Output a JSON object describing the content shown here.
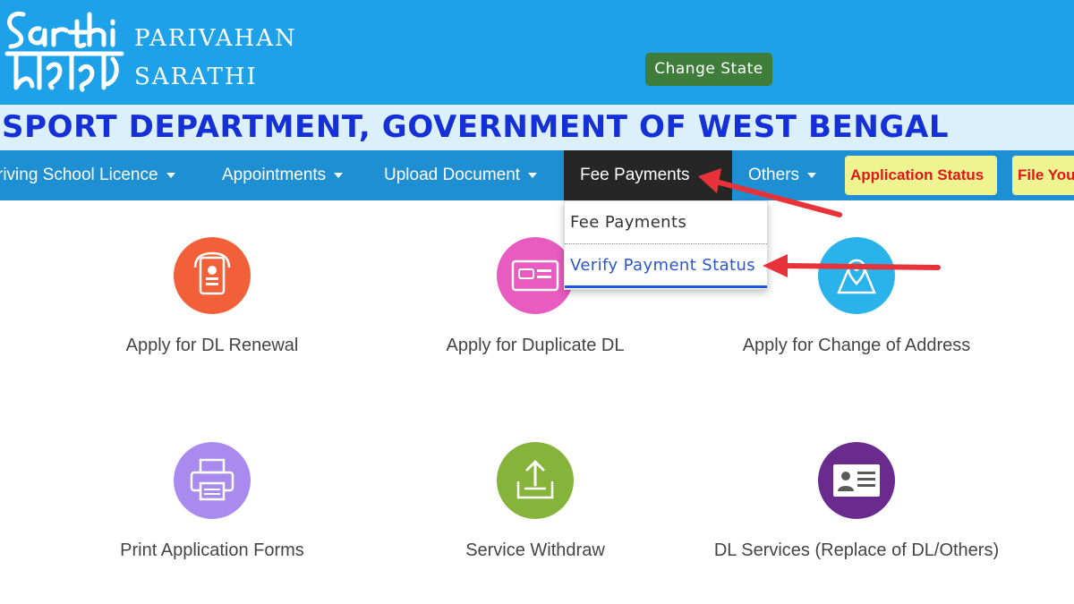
{
  "header": {
    "logo_line1": "PARIVAHAN",
    "logo_line2": "SARATHI",
    "change_state_label": "Change State",
    "brand_color": "#1da1e8"
  },
  "department": {
    "title": "SPORT DEPARTMENT, GOVERNMENT OF WEST BENGAL"
  },
  "nav": {
    "items": [
      {
        "label": "riving School Licence",
        "dropdown": true
      },
      {
        "label": "Appointments",
        "dropdown": true
      },
      {
        "label": "Upload Document",
        "dropdown": true
      },
      {
        "label": "Fee Payments",
        "dropdown": false,
        "active": true
      },
      {
        "label": "Others",
        "dropdown": true
      }
    ],
    "pills": [
      {
        "label": "Application Status"
      },
      {
        "label": "File You"
      }
    ]
  },
  "dropdown": {
    "items": [
      {
        "label": "Fee Payments"
      },
      {
        "label": "Verify Payment Status",
        "highlighted": true
      }
    ]
  },
  "services": [
    {
      "label": "Apply for DL Renewal",
      "icon": "id-badge-icon",
      "color": "#f2603a"
    },
    {
      "label": "Apply for Duplicate DL",
      "icon": "id-card-icon",
      "color": "#e85bc0"
    },
    {
      "label": "Apply for Change of Address",
      "icon": "map-pin-icon",
      "color": "#2ab3ea"
    },
    {
      "label": "Print Application Forms",
      "icon": "printer-icon",
      "color": "#a98bf0"
    },
    {
      "label": "Service Withdraw",
      "icon": "upload-tray-icon",
      "color": "#86b43a"
    },
    {
      "label": "DL Services (Replace of DL/Others)",
      "icon": "id-card-icon",
      "color": "#6a2a8e"
    }
  ],
  "annotation_color": "#e8323a"
}
